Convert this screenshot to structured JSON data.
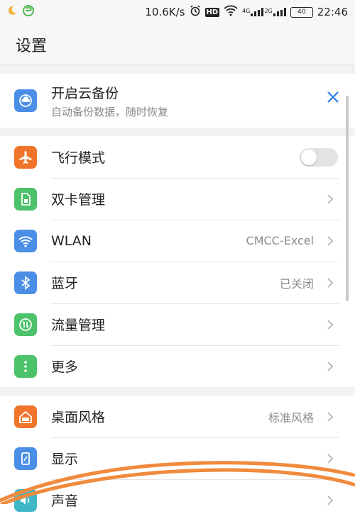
{
  "status_bar": {
    "speed": "10.6K/s",
    "hd_badge": "HD",
    "sim1_net": "4G",
    "sim2_net": "2G",
    "battery": "40",
    "time": "22:46",
    "icons": [
      "moon-icon",
      "browser-e-icon",
      "alarm-icon",
      "wifi-icon",
      "signal-icon",
      "battery-icon"
    ]
  },
  "header": {
    "title": "设置"
  },
  "backup_card": {
    "title": "开启云备份",
    "subtitle": "自动备份数据，随时恢复",
    "icon": "cloud-backup-icon"
  },
  "group1": [
    {
      "label": "飞行模式",
      "icon": "airplane-icon",
      "color": "#f0742a",
      "control": "toggle",
      "toggle_on": false
    },
    {
      "label": "双卡管理",
      "icon": "sim-card-icon",
      "color": "#4cc26b",
      "control": "chevron"
    },
    {
      "label": "WLAN",
      "value": "CMCC-Excel",
      "icon": "wifi-icon",
      "color": "#4a8ee6",
      "control": "chevron"
    },
    {
      "label": "蓝牙",
      "value": "已关闭",
      "icon": "bluetooth-icon",
      "color": "#4a8ee6",
      "control": "chevron"
    },
    {
      "label": "流量管理",
      "icon": "data-usage-icon",
      "color": "#4cc26b",
      "control": "chevron"
    },
    {
      "label": "更多",
      "icon": "more-icon",
      "color": "#4cc26b",
      "control": "chevron"
    }
  ],
  "group2": [
    {
      "label": "桌面风格",
      "value": "标准风格",
      "icon": "home-icon",
      "color": "#f0742a",
      "control": "chevron"
    },
    {
      "label": "显示",
      "icon": "display-icon",
      "color": "#4a8ee6",
      "control": "chevron"
    },
    {
      "label": "声音",
      "icon": "sound-icon",
      "color": "#3fb7c7",
      "control": "chevron"
    }
  ],
  "colors": {
    "accent": "#2b7de1",
    "scribble": "#f08a3c"
  }
}
